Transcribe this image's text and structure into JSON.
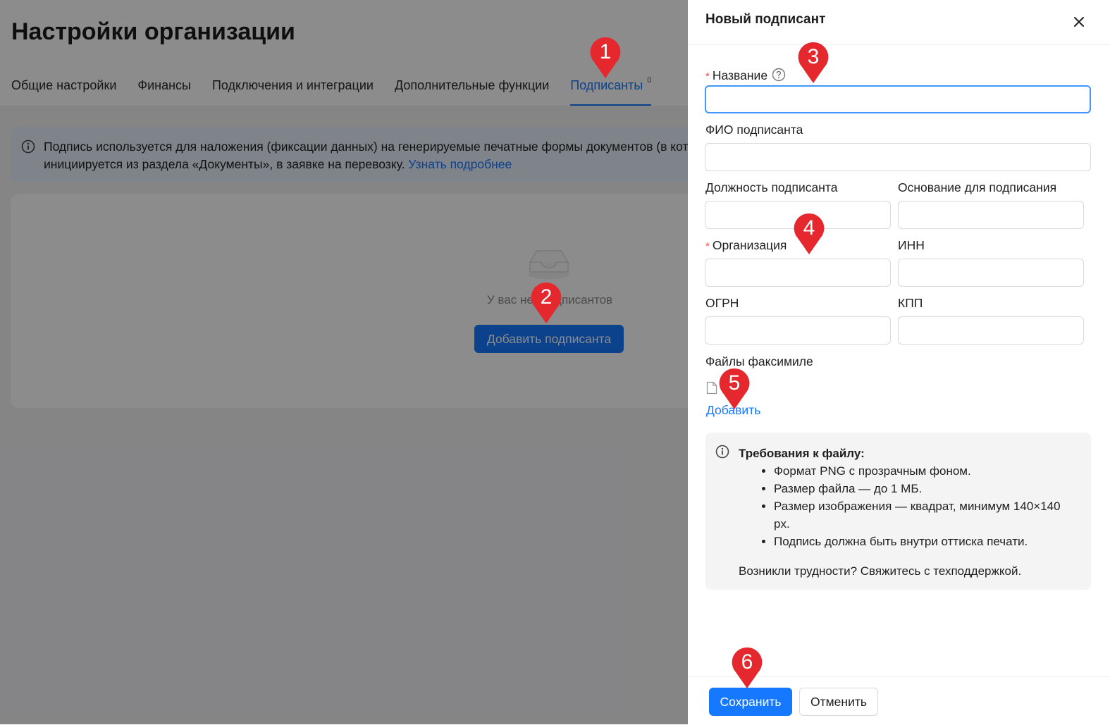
{
  "page": {
    "title": "Настройки организации",
    "tabs": [
      {
        "label": "Общие настройки"
      },
      {
        "label": "Финансы"
      },
      {
        "label": "Подключения и интеграции"
      },
      {
        "label": "Дополнительные функции"
      },
      {
        "label": "Подписанты",
        "count": "0",
        "active": true
      }
    ],
    "banner": {
      "line1": "Подпись используется для наложения (фиксации данных) на генерируемые печатные формы документов (в которые",
      "line2": "инициируется из раздела «Документы», в заявке на перевозку.",
      "link": "Узнать подробнее"
    },
    "empty_state": {
      "text": "У вас нет подписантов",
      "add_button": "Добавить подписанта"
    }
  },
  "drawer": {
    "title": "Новый подписант",
    "required_mark": "*",
    "fields": {
      "name": {
        "label": "Название",
        "value": ""
      },
      "fio": {
        "label": "ФИО подписанта",
        "value": ""
      },
      "position": {
        "label": "Должность подписанта",
        "value": ""
      },
      "basis": {
        "label": "Основание для подписания",
        "value": ""
      },
      "organization": {
        "label": "Организация",
        "value": ""
      },
      "inn": {
        "label": "ИНН",
        "value": ""
      },
      "ogrn": {
        "label": "ОГРН",
        "value": ""
      },
      "kpp": {
        "label": "КПП",
        "value": ""
      }
    },
    "files": {
      "label": "Файлы факсимиле",
      "add_link": "Добавить"
    },
    "requirements": {
      "title": "Требования к файлу:",
      "items": [
        "Формат PNG с прозрачным фоном.",
        "Размер файла — до 1 МБ.",
        "Размер изображения — квадрат, минимум 140×140 px.",
        "Подпись должна быть внутри оттиска печати."
      ],
      "footer": "Возникли трудности? Свяжитесь с техподдержкой."
    },
    "save_label": "Сохранить",
    "cancel_label": "Отменить"
  },
  "markers": [
    "1",
    "2",
    "3",
    "4",
    "5",
    "6"
  ],
  "colors": {
    "primary": "#1677ff",
    "marker": "#e5282e",
    "required": "#ff4d4f",
    "overlay": "rgba(0,0,0,0.45)"
  }
}
